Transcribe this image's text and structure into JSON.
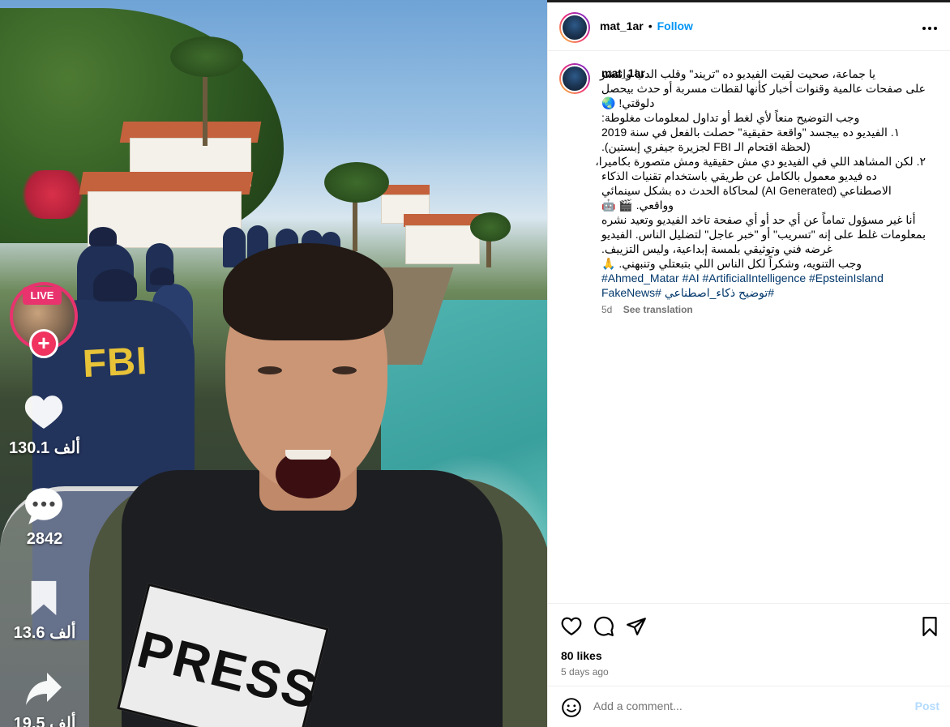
{
  "post": {
    "username": "mat_1ar",
    "follow_label": "Follow",
    "separator": "•",
    "caption_lines": [
      "يا جماعة، صحيت لقيت الفيديو ده \"تريند\" وقلب الدنيا وانتشر",
      "على صفحات عالمية وقنوات أخبار كأنها لقطات مسربة أو حدث بيحصل",
      "دلوقتي! 🌏",
      "وجب التوضيح منعاً لأي لغط أو تداول لمعلومات مغلوطة:",
      "١. الفيديو ده بيجسد \"واقعة حقيقية\" حصلت بالفعل في سنة 2019",
      "(لحظة اقتحام الـ FBI لجزيرة جيفري إبستين).",
      "٢. لكن المشاهد اللي في الفيديو دي مش حقيقية ومش متصورة بكاميرا،",
      "ده فيديو معمول بالكامل عن طريقي باستخدام تقنيات الذكاء",
      "الاصطناعي (AI Generated) لمحاكاة الحدث ده بشكل سينمائي",
      "وواقعي. 🎬 🤖",
      "أنا غير مسؤول تماماً عن أي حد أو أي صفحة تاخد الفيديو وتعيد نشره",
      "بمعلومات غلط على إنه \"تسريب\" أو \"خبر عاجل\" لتضليل الناس. الفيديو",
      "غرضه فني وتوثيقي بلمسة إبداعية، وليس التزييف.",
      "وجب التنويه، وشكراً لكل الناس اللي بتبعتلي وتنبهني. 🙏"
    ],
    "hashtag_line_1": "#Ahmed_Matar #AI #ArtificialIntelligence #EpsteinIsland",
    "hashtag_line_2": "#توضيح ذكاء_اصطناعي #FakeNews",
    "caption_age": "5d",
    "see_translation": "See translation",
    "likes": "80 likes",
    "posted": "5 days ago",
    "comment_placeholder": "Add a comment...",
    "post_label": "Post"
  },
  "video_overlay": {
    "live_badge": "LIVE",
    "likes_count": "130.1 ألف",
    "comments_count": "2842",
    "saves_count": "13.6 ألف",
    "shares_count": "19.5 ألف",
    "jacket_text": "FBI",
    "vest_text": "PRESS"
  },
  "icons": {
    "more": "more-options-icon",
    "like": "heart-icon",
    "comment": "comment-icon",
    "share": "send-icon",
    "save": "bookmark-icon",
    "emoji": "emoji-icon"
  },
  "colors": {
    "follow": "#0095f6",
    "live": "#e8336e",
    "hashtag": "#00376b",
    "muted": "#737373"
  }
}
